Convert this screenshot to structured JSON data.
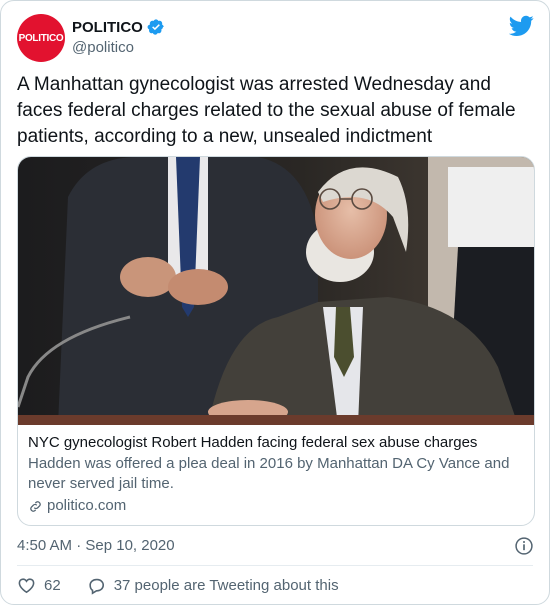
{
  "tweet": {
    "avatar_text": "POLITICO",
    "display_name": "POLITICO",
    "handle": "@politico",
    "text": "A Manhattan gynecologist was arrested Wednesday and faces federal charges related to the sexual abuse of female patients, according to a new, unsealed indictment",
    "timestamp": "4:50 AM · Sep 10, 2020",
    "like_count": "62",
    "tweeting_about": "37 people are Tweeting about this"
  },
  "link_card": {
    "title": "NYC gynecologist Robert Hadden facing federal sex abuse charges",
    "description": "Hadden was offered a plea deal in 2016 by Manhattan DA Cy Vance and never served jail time.",
    "domain": "politico.com"
  },
  "colors": {
    "brand_red": "#e2122f",
    "twitter_blue": "#1d9bf0",
    "secondary_text": "#536471",
    "border": "#cfd9de"
  },
  "icons": {
    "verified": "verified-badge-icon",
    "twitter": "twitter-bird-icon",
    "info": "info-icon",
    "like": "heart-icon",
    "reply": "speech-bubble-icon",
    "link": "link-icon"
  }
}
